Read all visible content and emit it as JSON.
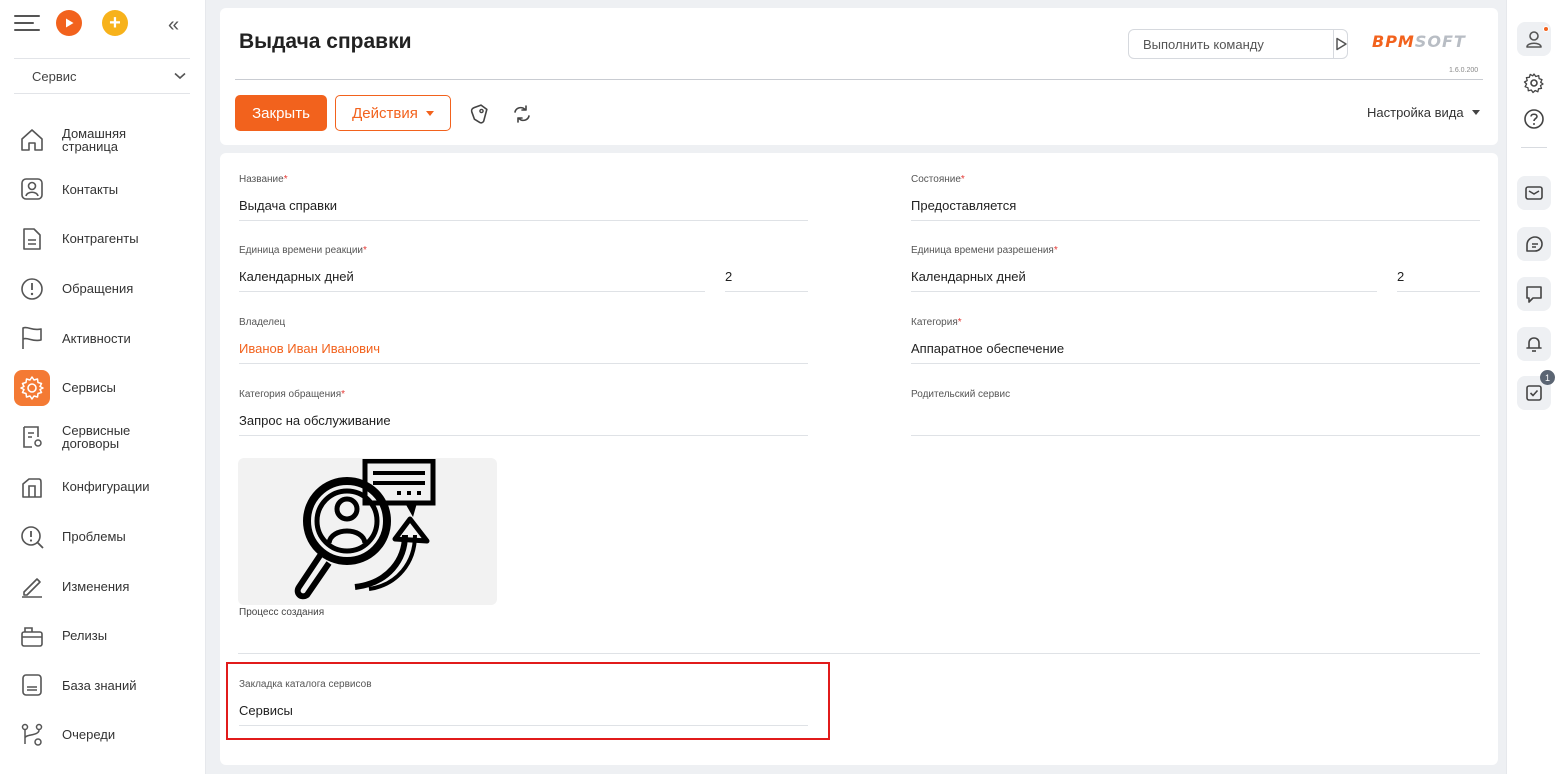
{
  "sidebar": {
    "workspace": "Сервис",
    "items": [
      {
        "label": "Домашняя\nстраница",
        "icon": "home-icon"
      },
      {
        "label": "Контакты",
        "icon": "contact-icon"
      },
      {
        "label": "Контрагенты",
        "icon": "document-icon"
      },
      {
        "label": "Обращения",
        "icon": "exclamation-icon"
      },
      {
        "label": "Активности",
        "icon": "flag-icon"
      },
      {
        "label": "Сервисы",
        "icon": "gear-icon",
        "active": true
      },
      {
        "label": "Сервисные\nдоговоры",
        "icon": "contract-icon"
      },
      {
        "label": "Конфигурации",
        "icon": "configuration-icon"
      },
      {
        "label": "Проблемы",
        "icon": "problem-icon"
      },
      {
        "label": "Изменения",
        "icon": "pencil-icon"
      },
      {
        "label": "Релизы",
        "icon": "release-icon"
      },
      {
        "label": "База знаний",
        "icon": "book-icon"
      },
      {
        "label": "Очереди",
        "icon": "queue-icon"
      }
    ]
  },
  "header": {
    "title": "Выдача справки",
    "command_placeholder": "Выполнить команду",
    "logo_part1": "BPM",
    "logo_part2": "SOFT",
    "version": "1.6.0.200",
    "close_label": "Закрыть",
    "actions_label": "Действия",
    "view_settings_label": "Настройка вида"
  },
  "form": {
    "name": {
      "label": "Название",
      "required": "*",
      "value": "Выдача справки"
    },
    "state": {
      "label": "Состояние",
      "required": "*",
      "value": "Предоставляется"
    },
    "reaction_unit": {
      "label": "Единица времени реакции",
      "required": "*",
      "value": "Календарных дней",
      "amount": "2"
    },
    "resolution_unit": {
      "label": "Единица времени разрешения",
      "required": "*",
      "value": "Календарных дней",
      "amount": "2"
    },
    "owner": {
      "label": "Владелец",
      "value": "Иванов Иван Иванович"
    },
    "category": {
      "label": "Категория",
      "required": "*",
      "value": "Аппаратное обеспечение"
    },
    "case_category": {
      "label": "Категория обращения",
      "required": "*",
      "value": "Запрос на обслуживание"
    },
    "parent_service": {
      "label": "Родительский сервис",
      "value": ""
    },
    "creation_process": {
      "label": "Процесс создания"
    },
    "catalog_tab": {
      "label": "Закладка каталога сервисов",
      "value": "Сервисы"
    }
  },
  "rightbar": {
    "tasks_badge": "1"
  },
  "colors": {
    "accent": "#f2621d",
    "active_nav": "#f47a34",
    "highlight": "#e11b1b"
  }
}
